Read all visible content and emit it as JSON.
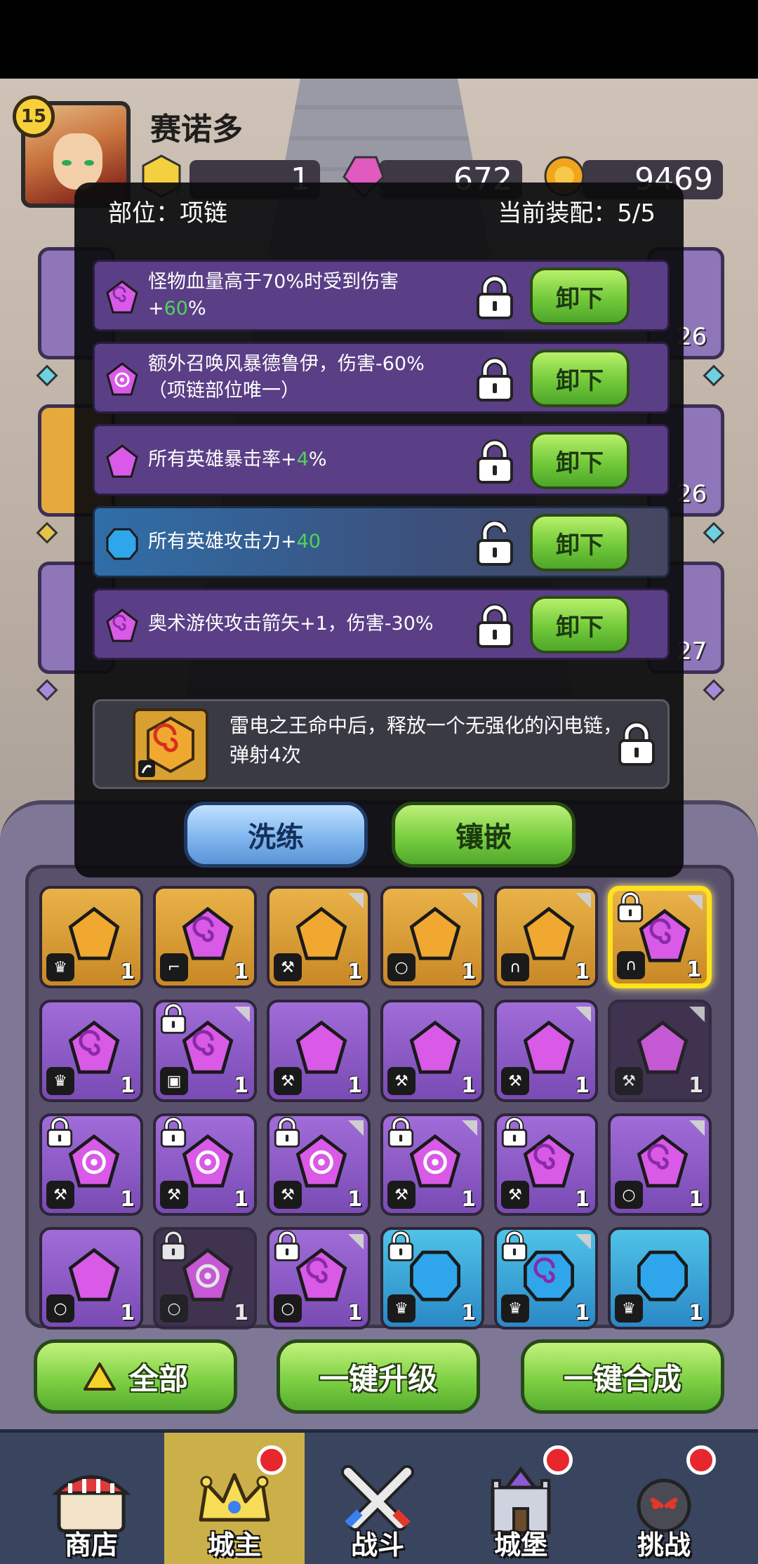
{
  "player": {
    "level": "15",
    "name": "赛诺多"
  },
  "resources": [
    {
      "name": "gold-crown",
      "value": "1",
      "color": "#f4d03f"
    },
    {
      "name": "pink-crystal",
      "value": "672",
      "color": "#e05bbf"
    },
    {
      "name": "coin",
      "value": "9469",
      "color": "#f0a51a"
    }
  ],
  "side_peeks": {
    "right_levels": [
      "26",
      "26",
      "27"
    ]
  },
  "modal": {
    "slot_label": "部位：项链",
    "equip_count": "当前装配：5/5",
    "effects": [
      {
        "prefix": "怪物血量高于70%时受到伤害+",
        "highlight": "60",
        "suffix": "%",
        "gem": "purple-swirl",
        "locked": true,
        "button": "卸下"
      },
      {
        "prefix": "额外召唤风暴德鲁伊，伤害-60%（项链部位唯一）",
        "highlight": "",
        "suffix": "",
        "gem": "purple-burst",
        "locked": true,
        "button": "卸下"
      },
      {
        "prefix": "所有英雄暴击率+",
        "highlight": "4",
        "suffix": "%",
        "gem": "purple-plain",
        "locked": true,
        "button": "卸下"
      },
      {
        "prefix": "所有英雄攻击力+",
        "highlight": "40",
        "suffix": "",
        "gem": "blue-plain",
        "locked": false,
        "button": "卸下"
      },
      {
        "prefix": "奥术游侠攻击箭矢+1，伤害-30%",
        "highlight": "",
        "suffix": "",
        "gem": "purple-swirl",
        "locked": true,
        "button": "卸下"
      }
    ],
    "special": {
      "text": "雷电之王命中后，释放一个无强化的闪电链，弹射4次",
      "locked": true
    },
    "wash_button": "洗练",
    "inlay_button": "镶嵌"
  },
  "inventory": {
    "rows": [
      [
        {
          "color": "gold",
          "gem": "plain",
          "tag": "crown",
          "count": "1",
          "locked": false,
          "corner": false
        },
        {
          "color": "gold",
          "gem": "swirl",
          "tag": "boot",
          "count": "1",
          "locked": false,
          "corner": false
        },
        {
          "color": "gold",
          "gem": "plain",
          "tag": "axe",
          "count": "1",
          "locked": false,
          "corner": true
        },
        {
          "color": "gold",
          "gem": "plain",
          "tag": "ring",
          "count": "1",
          "locked": false,
          "corner": true
        },
        {
          "color": "gold",
          "gem": "plain",
          "tag": "necklace",
          "count": "1",
          "locked": false,
          "corner": true
        },
        {
          "color": "gold",
          "gem": "swirl",
          "tag": "necklace",
          "count": "1",
          "locked": true,
          "corner": true,
          "selected": true
        }
      ],
      [
        {
          "color": "purple",
          "gem": "swirl",
          "tag": "crown",
          "count": "1",
          "locked": false,
          "corner": false
        },
        {
          "color": "purple",
          "gem": "swirl",
          "tag": "shirt",
          "count": "1",
          "locked": true,
          "corner": true
        },
        {
          "color": "purple",
          "gem": "plain",
          "tag": "axe",
          "count": "1",
          "locked": false,
          "corner": false
        },
        {
          "color": "purple",
          "gem": "plain",
          "tag": "axe",
          "count": "1",
          "locked": false,
          "corner": false
        },
        {
          "color": "purple",
          "gem": "plain",
          "tag": "axe",
          "count": "1",
          "locked": false,
          "corner": true
        },
        {
          "color": "dark",
          "gem": "plain",
          "tag": "axe",
          "count": "1",
          "locked": false,
          "corner": true
        }
      ],
      [
        {
          "color": "purple",
          "gem": "burst",
          "tag": "axe",
          "count": "1",
          "locked": true,
          "corner": false
        },
        {
          "color": "purple",
          "gem": "burst",
          "tag": "axe",
          "count": "1",
          "locked": true,
          "corner": false
        },
        {
          "color": "purple",
          "gem": "burst",
          "tag": "axe",
          "count": "1",
          "locked": true,
          "corner": true
        },
        {
          "color": "purple",
          "gem": "burst",
          "tag": "axe",
          "count": "1",
          "locked": true,
          "corner": true
        },
        {
          "color": "purple",
          "gem": "swirl",
          "tag": "axe",
          "count": "1",
          "locked": true,
          "corner": false
        },
        {
          "color": "purple",
          "gem": "swirl",
          "tag": "ring",
          "count": "1",
          "locked": false,
          "corner": true
        }
      ],
      [
        {
          "color": "purple",
          "gem": "plain",
          "tag": "ring",
          "count": "1",
          "locked": false,
          "corner": false
        },
        {
          "color": "dark",
          "gem": "burst",
          "tag": "ring",
          "count": "1",
          "locked": true,
          "corner": false
        },
        {
          "color": "purple",
          "gem": "swirl",
          "tag": "ring",
          "count": "1",
          "locked": true,
          "corner": true
        },
        {
          "color": "blue",
          "gem": "plain",
          "tag": "crown",
          "count": "1",
          "locked": true,
          "corner": false
        },
        {
          "color": "blue",
          "gem": "swirl",
          "tag": "crown",
          "count": "1",
          "locked": true,
          "corner": true
        },
        {
          "color": "blue",
          "gem": "plain",
          "tag": "crown",
          "count": "1",
          "locked": false,
          "corner": false
        }
      ]
    ]
  },
  "actions": {
    "all": "全部",
    "upgrade": "一键升级",
    "merge": "一键合成"
  },
  "nav": [
    {
      "label": "商店",
      "icon": "shop-icon",
      "active": false,
      "dot": false
    },
    {
      "label": "城主",
      "icon": "crown-icon",
      "active": true,
      "dot": true
    },
    {
      "label": "战斗",
      "icon": "swords-icon",
      "active": false,
      "dot": false
    },
    {
      "label": "城堡",
      "icon": "castle-icon",
      "active": false,
      "dot": true
    },
    {
      "label": "挑战",
      "icon": "bomb-icon",
      "active": false,
      "dot": true
    }
  ]
}
